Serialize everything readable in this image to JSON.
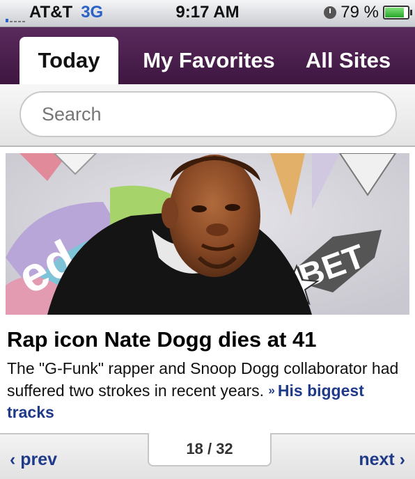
{
  "status_bar": {
    "carrier": "AT&T",
    "network": "3G",
    "time": "9:17 AM",
    "battery": "79 %",
    "icons": [
      "signal-icon",
      "clock-icon",
      "battery-icon"
    ]
  },
  "tabs": [
    {
      "label": "Today",
      "active": true
    },
    {
      "label": "My Favorites",
      "active": false
    },
    {
      "label": "All Sites",
      "active": false
    }
  ],
  "search": {
    "placeholder": "Search"
  },
  "article": {
    "photo_overlay_text": [
      "ed",
      "BET"
    ],
    "headline": "Rap icon Nate Dogg dies at 41",
    "summary": "The \"G-Funk\" rapper and Snoop Dogg collaborator had suffered two strokes in recent years.",
    "link_arrows": "»",
    "link_label": "His biggest tracks"
  },
  "pager": {
    "prev_label": "‹ prev",
    "next_label": "next ›",
    "current": "18",
    "separator": "/",
    "total": "32"
  },
  "colors": {
    "tab_bar": "#4a1f4d",
    "link": "#203a8a",
    "network": "#2a62c7"
  }
}
